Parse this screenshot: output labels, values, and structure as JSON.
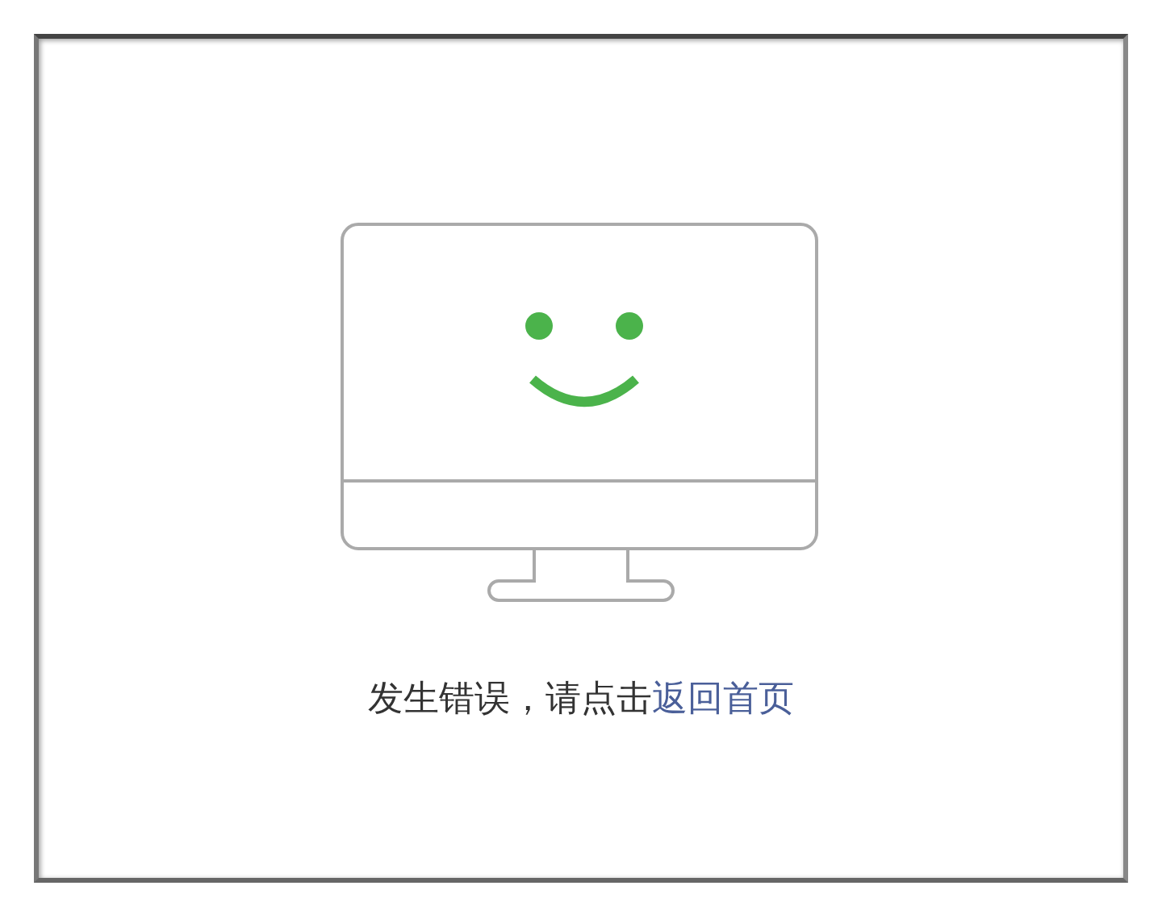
{
  "message": {
    "text": "发生错误，请点击",
    "link": "返回首页"
  }
}
